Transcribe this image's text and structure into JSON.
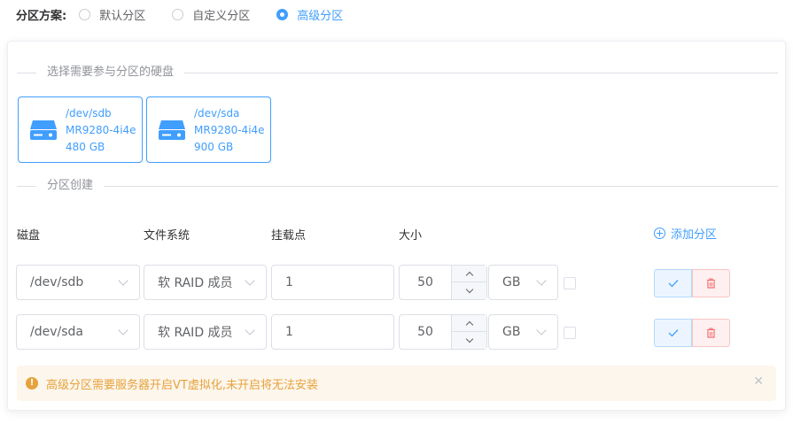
{
  "scheme": {
    "label": "分区方案:",
    "options": [
      "默认分区",
      "自定义分区",
      "高级分区"
    ],
    "selected_index": 2
  },
  "disk_section": {
    "title": "选择需要参与分区的硬盘"
  },
  "disks": [
    {
      "device": "/dev/sdb",
      "model": "MR9280-4i4e",
      "size": "480 GB",
      "selected": true
    },
    {
      "device": "/dev/sda",
      "model": "MR9280-4i4e",
      "size": "900 GB",
      "selected": true
    }
  ],
  "partition_section": {
    "title": "分区创建"
  },
  "table_headers": {
    "disk": "磁盘",
    "filesystem": "文件系统",
    "mount": "挂载点",
    "size": "大小"
  },
  "add_partition_label": "添加分区",
  "rows": [
    {
      "disk": "/dev/sdb",
      "filesystem": "软 RAID 成员",
      "mount": "1",
      "size": "50",
      "unit": "GB",
      "checked": false
    },
    {
      "disk": "/dev/sda",
      "filesystem": "软 RAID 成员",
      "mount": "1",
      "size": "50",
      "unit": "GB",
      "checked": false
    }
  ],
  "alert": {
    "text": "高级分区需要服务器开启VT虚拟化,未开启将无法安装",
    "icon": "warning-icon",
    "color": "#e6a23c"
  },
  "colors": {
    "primary": "#409eff",
    "danger": "#f56c6c",
    "warning": "#e6a23c"
  }
}
